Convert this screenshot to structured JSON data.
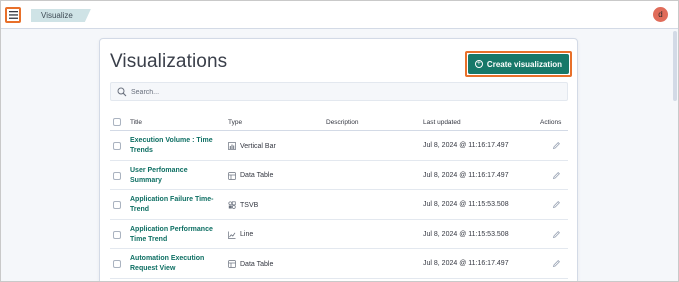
{
  "header": {
    "breadcrumb": "Visualize",
    "avatar_initial": "d"
  },
  "main": {
    "title": "Visualizations",
    "create_label": "Create visualization",
    "search_placeholder": "Search...",
    "columns": {
      "title": "Title",
      "type": "Type",
      "description": "Description",
      "updated": "Last updated",
      "actions": "Actions"
    },
    "rows": [
      {
        "title": "Execution Volume : Time Trends",
        "type": "Vertical Bar",
        "type_icon": "bar-chart-icon",
        "description": "",
        "updated": "Jul 8, 2024 @ 11:16:17.497"
      },
      {
        "title": "User Perfomance Summary",
        "type": "Data Table",
        "type_icon": "table-icon",
        "description": "",
        "updated": "Jul 8, 2024 @ 11:16:17.497"
      },
      {
        "title": "Application Failure Time-Trend",
        "type": "TSVB",
        "type_icon": "tsvb-icon",
        "description": "",
        "updated": "Jul 8, 2024 @ 11:15:53.508"
      },
      {
        "title": "Application Performance Time Trend",
        "type": "Line",
        "type_icon": "line-chart-icon",
        "description": "",
        "updated": "Jul 8, 2024 @ 11:15:53.508"
      },
      {
        "title": "Automation Execution Request View",
        "type": "Data Table",
        "type_icon": "table-icon",
        "description": "",
        "updated": "Jul 8, 2024 @ 11:16:17.497"
      }
    ]
  },
  "colors": {
    "accent": "#177869",
    "link": "#0e6f63",
    "highlight": "#e8702a",
    "avatar": "#e06c5a"
  }
}
